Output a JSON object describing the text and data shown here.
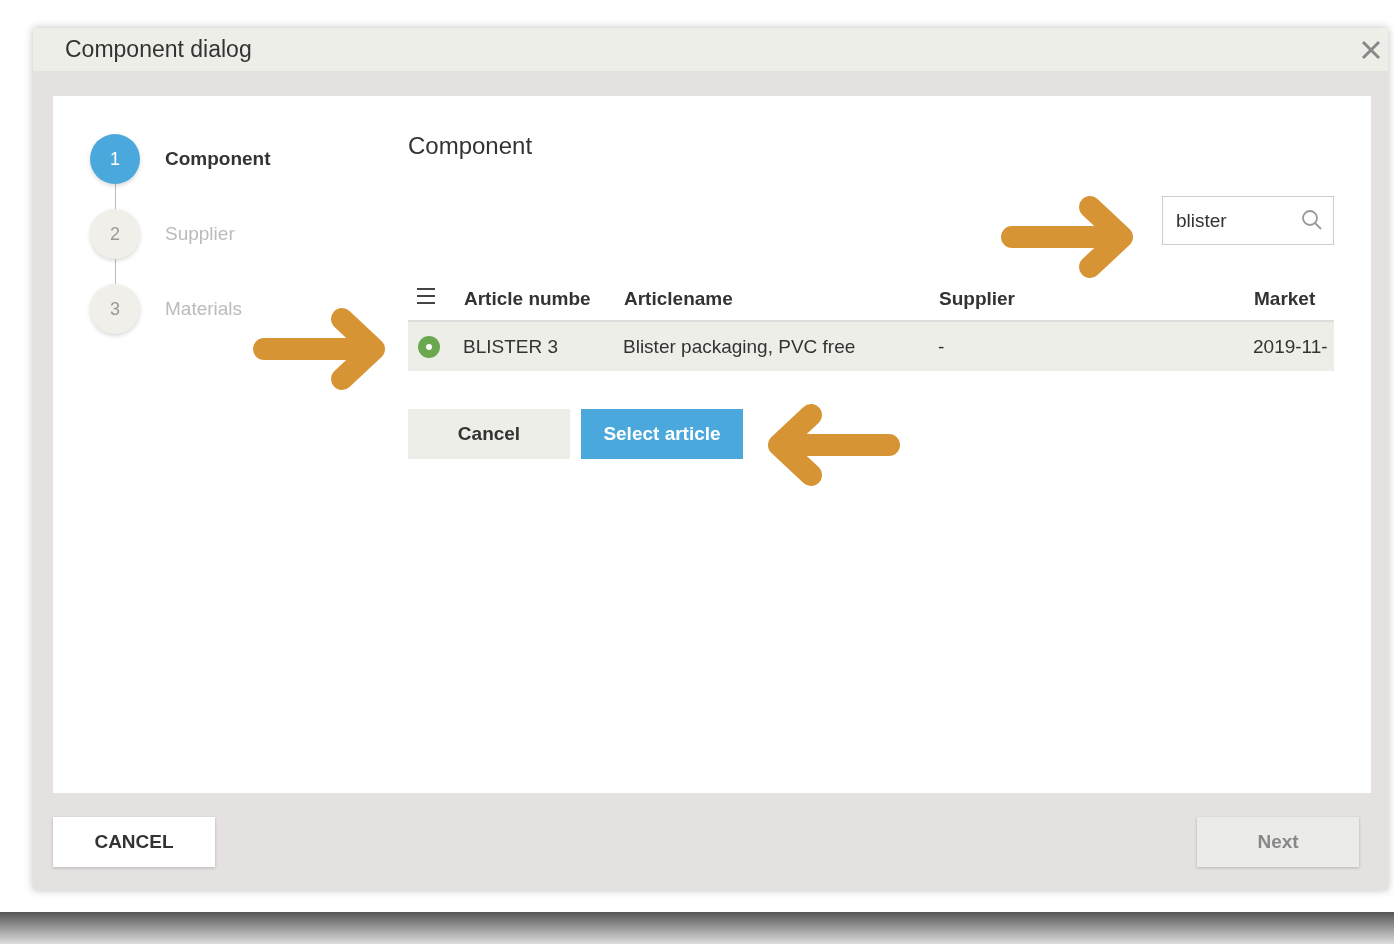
{
  "window": {
    "title": "Component dialog"
  },
  "steps": [
    {
      "number": "1",
      "label": "Component",
      "selected": true
    },
    {
      "number": "2",
      "label": "Supplier",
      "selected": false
    },
    {
      "number": "3",
      "label": "Materials",
      "selected": false
    }
  ],
  "section_title": "Component",
  "search": {
    "value": "blister"
  },
  "table": {
    "columns": [
      "Article numbe",
      "Articlename",
      "Supplier",
      "Market"
    ],
    "rows": [
      {
        "color": "#6aa84f",
        "selected": true,
        "cells": [
          "BLISTER 3",
          "Blister packaging, PVC free",
          "-",
          "2019-11-"
        ]
      }
    ]
  },
  "actions": [
    {
      "label": "Cancel",
      "kind": "secondary"
    },
    {
      "label": "Select article",
      "kind": "primary"
    }
  ],
  "footer": {
    "cancel": "CANCEL",
    "next": {
      "label": "Next",
      "disabled": true
    }
  }
}
